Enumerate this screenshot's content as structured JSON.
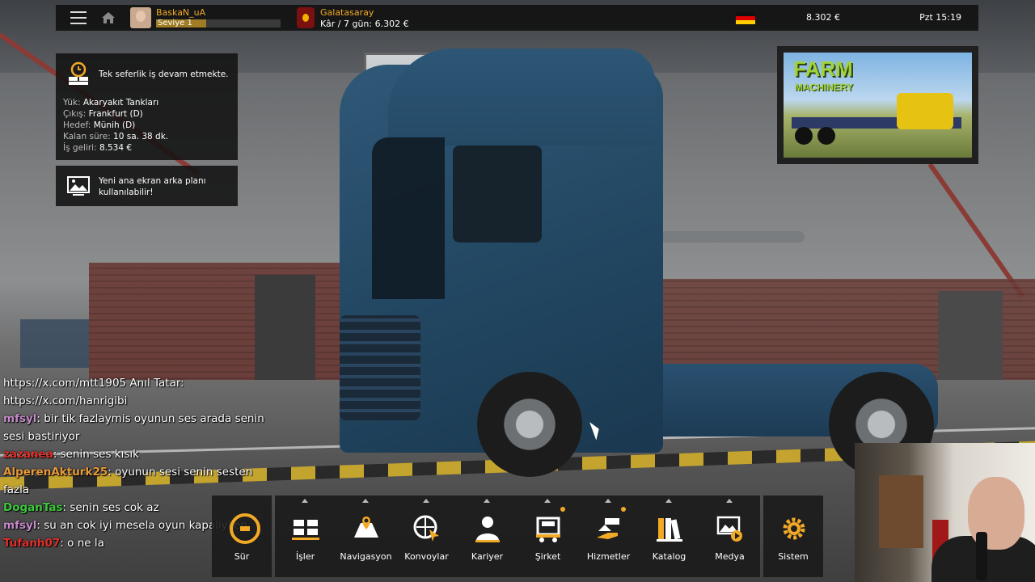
{
  "topbar": {
    "user_name": "BaskaN_uA",
    "level_label": "Seviye 1",
    "level_progress": 0.4,
    "company_name": "Galatasaray",
    "company_stat": "Kâr / 7 gün: 6.302 €",
    "country_flag": "Germany",
    "money": "8.302 €",
    "clock": "Pzt 15:19"
  },
  "notifications": {
    "job": {
      "title": "Tek seferlik iş devam etmekte.",
      "lines": [
        {
          "key": "Yük:",
          "value": "Akaryakıt Tankları"
        },
        {
          "key": "Çıkış:",
          "value": "Frankfurt (D)"
        },
        {
          "key": "Hedef:",
          "value": "Münih (D)"
        },
        {
          "key": "Kalan süre:",
          "value": "10 sa. 38 dk."
        },
        {
          "key": "İş geliri:",
          "value": "8.534 €"
        }
      ]
    },
    "background": {
      "title_line1": "Yeni ana ekran arka planı",
      "title_line2": "kullanılabilir!"
    }
  },
  "promo": {
    "title": "FARM",
    "subtitle": "MACHINERY"
  },
  "chat": [
    {
      "user": "https://x.com/mtt1905 Anıl Tatar:",
      "text": "https://x.com/hanrigibi",
      "color": "#ffffff",
      "line_break": true
    },
    {
      "user": "mfsyl",
      "text": ": bir tik fazlaymis oyunun ses arada senin sesi bastiriyor",
      "color": "#c58ac9"
    },
    {
      "user": "zazanea",
      "text": ": senin ses kısık",
      "color": "#e0302a"
    },
    {
      "user": "AlperenAkturk25",
      "text": ": oyunun sesi senin sesten fazla",
      "color": "#e89a3a"
    },
    {
      "user": "DoganTas",
      "text": ": senin ses cok az",
      "color": "#3fc83f"
    },
    {
      "user": "mfsyl",
      "text": ": su an cok iyi mesela oyun kapaliyken",
      "color": "#c58ac9"
    },
    {
      "user": "Tufanh07",
      "text": ": o ne la",
      "color": "#e0302a"
    }
  ],
  "dock": {
    "drive_label": "Sür",
    "items": [
      {
        "label": "İşler",
        "icon": "jobs-icon",
        "dot": false
      },
      {
        "label": "Navigasyon",
        "icon": "navigation-icon",
        "dot": false
      },
      {
        "label": "Konvoylar",
        "icon": "convoy-icon",
        "dot": false
      },
      {
        "label": "Kariyer",
        "icon": "career-icon",
        "dot": false
      },
      {
        "label": "Şirket",
        "icon": "company-icon",
        "dot": true
      },
      {
        "label": "Hizmetler",
        "icon": "services-icon",
        "dot": true
      },
      {
        "label": "Katalog",
        "icon": "catalog-icon",
        "dot": false
      },
      {
        "label": "Medya",
        "icon": "media-icon",
        "dot": false
      }
    ],
    "system_label": "Sistem"
  },
  "colors": {
    "accent": "#f2a925",
    "panel": "#121212"
  }
}
